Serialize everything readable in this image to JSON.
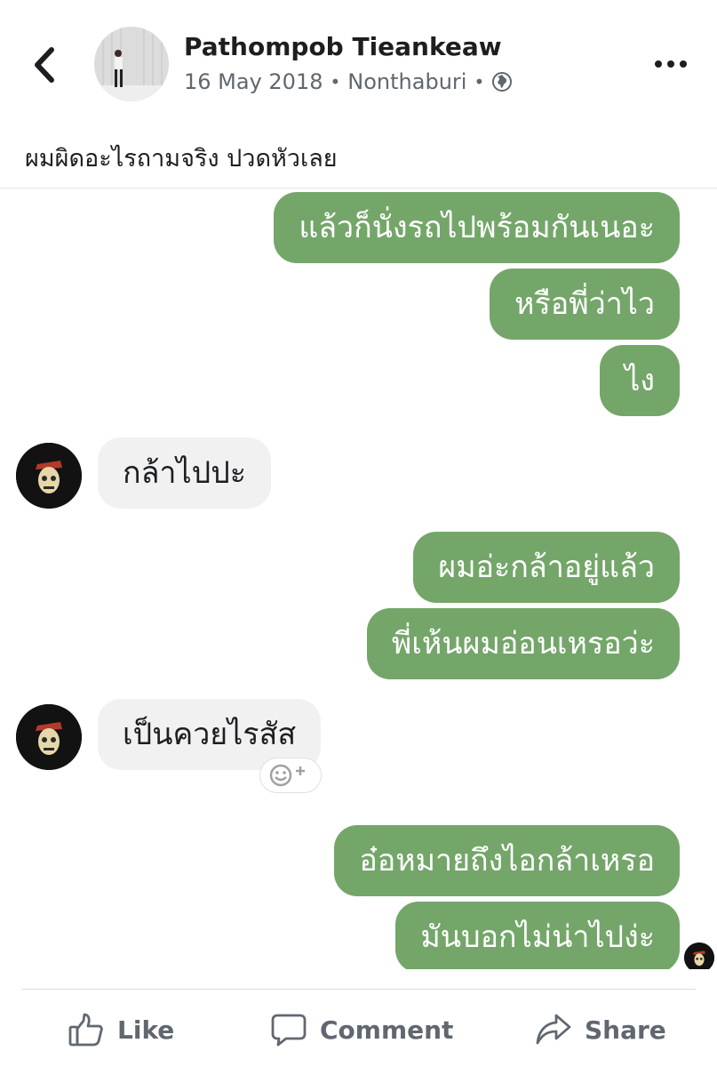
{
  "post": {
    "author": "Pathompob Tieankeaw",
    "date": "16 May 2018",
    "location": "Nonthaburi",
    "caption": "ผมผิดอะไรถามจริง ปวดหัวเลย",
    "icons": {
      "back": "chevron-left-icon",
      "privacy": "globe-icon",
      "more": "more-options-icon"
    }
  },
  "chat": {
    "messages": [
      {
        "side": "sent",
        "text": "แล้วก็นั่งรถไปพร้อมกันเนอะ"
      },
      {
        "side": "sent",
        "text": "หรือพี่ว่าไว"
      },
      {
        "side": "sent",
        "text": "ไง"
      },
      {
        "side": "received",
        "text": "กล้าไปปะ"
      },
      {
        "side": "sent",
        "text": "ผมอ่ะกล้าอยู่แล้ว"
      },
      {
        "side": "sent",
        "text": "พี่เห้นผมอ่อนเหรอว่ะ"
      },
      {
        "side": "received",
        "text": "เป็นควยไรสัส"
      },
      {
        "side": "sent",
        "text": "อ๋อหมายถึงไอกล้าเหรอ"
      },
      {
        "side": "sent",
        "text": "มันบอกไม่น่าไปง่ะ"
      }
    ],
    "reaction_icon": "add-reaction-icon",
    "colors": {
      "sent_bubble": "#74a66a",
      "received_bubble": "#f1f1f1"
    }
  },
  "actions": {
    "like": "Like",
    "comment": "Comment",
    "share": "Share"
  }
}
